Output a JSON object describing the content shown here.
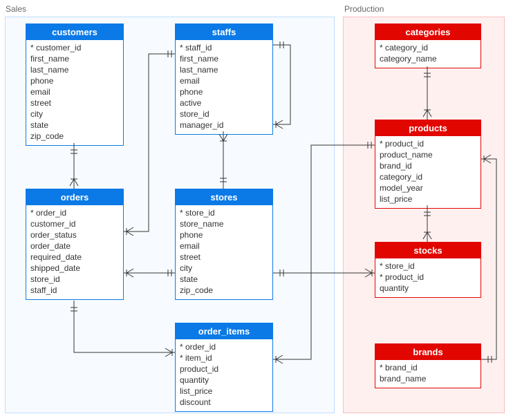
{
  "schemas": {
    "sales": {
      "label": "Sales"
    },
    "production": {
      "label": "Production"
    }
  },
  "entities": {
    "customers": {
      "title": "customers",
      "cols": [
        "* customer_id",
        "first_name",
        "last_name",
        "phone",
        "email",
        "street",
        "city",
        "state",
        "zip_code"
      ]
    },
    "staffs": {
      "title": "staffs",
      "cols": [
        "* staff_id",
        "first_name",
        "last_name",
        "email",
        "phone",
        "active",
        "store_id",
        "manager_id"
      ]
    },
    "orders": {
      "title": "orders",
      "cols": [
        "* order_id",
        "customer_id",
        "order_status",
        "order_date",
        "required_date",
        "shipped_date",
        "store_id",
        "staff_id"
      ]
    },
    "stores": {
      "title": "stores",
      "cols": [
        "* store_id",
        "store_name",
        "phone",
        "email",
        "street",
        "city",
        "state",
        "zip_code"
      ]
    },
    "order_items": {
      "title": "order_items",
      "cols": [
        "* order_id",
        "* item_id",
        "product_id",
        "quantity",
        "list_price",
        "discount"
      ]
    },
    "categories": {
      "title": "categories",
      "cols": [
        "* category_id",
        "category_name"
      ]
    },
    "products": {
      "title": "products",
      "cols": [
        "* product_id",
        "product_name",
        "brand_id",
        "category_id",
        "model_year",
        "list_price"
      ]
    },
    "stocks": {
      "title": "stocks",
      "cols": [
        "* store_id",
        "* product_id",
        "quantity"
      ]
    },
    "brands": {
      "title": "brands",
      "cols": [
        "* brand_id",
        "brand_name"
      ]
    }
  },
  "chart_data": {
    "type": "table",
    "title": "Database schema: Sales & Production",
    "schemas": [
      {
        "name": "Sales",
        "tables": [
          "customers",
          "staffs",
          "orders",
          "stores",
          "order_items"
        ]
      },
      {
        "name": "Production",
        "tables": [
          "categories",
          "products",
          "stocks",
          "brands"
        ]
      }
    ],
    "tables": {
      "customers": {
        "pk": [
          "customer_id"
        ],
        "columns": [
          "customer_id",
          "first_name",
          "last_name",
          "phone",
          "email",
          "street",
          "city",
          "state",
          "zip_code"
        ]
      },
      "staffs": {
        "pk": [
          "staff_id"
        ],
        "columns": [
          "staff_id",
          "first_name",
          "last_name",
          "email",
          "phone",
          "active",
          "store_id",
          "manager_id"
        ]
      },
      "orders": {
        "pk": [
          "order_id"
        ],
        "columns": [
          "order_id",
          "customer_id",
          "order_status",
          "order_date",
          "required_date",
          "shipped_date",
          "store_id",
          "staff_id"
        ]
      },
      "stores": {
        "pk": [
          "store_id"
        ],
        "columns": [
          "store_id",
          "store_name",
          "phone",
          "email",
          "street",
          "city",
          "state",
          "zip_code"
        ]
      },
      "order_items": {
        "pk": [
          "order_id",
          "item_id"
        ],
        "columns": [
          "order_id",
          "item_id",
          "product_id",
          "quantity",
          "list_price",
          "discount"
        ]
      },
      "categories": {
        "pk": [
          "category_id"
        ],
        "columns": [
          "category_id",
          "category_name"
        ]
      },
      "products": {
        "pk": [
          "product_id"
        ],
        "columns": [
          "product_id",
          "product_name",
          "brand_id",
          "category_id",
          "model_year",
          "list_price"
        ]
      },
      "stocks": {
        "pk": [
          "store_id",
          "product_id"
        ],
        "columns": [
          "store_id",
          "product_id",
          "quantity"
        ]
      },
      "brands": {
        "pk": [
          "brand_id"
        ],
        "columns": [
          "brand_id",
          "brand_name"
        ]
      }
    },
    "relationships": [
      {
        "from": "customers.customer_id",
        "to": "orders.customer_id",
        "type": "one-to-many"
      },
      {
        "from": "staffs.staff_id",
        "to": "orders.staff_id",
        "type": "one-to-many"
      },
      {
        "from": "staffs.staff_id",
        "to": "staffs.manager_id",
        "type": "one-to-many (self)"
      },
      {
        "from": "stores.store_id",
        "to": "staffs.store_id",
        "type": "one-to-many"
      },
      {
        "from": "stores.store_id",
        "to": "orders.store_id",
        "type": "one-to-many"
      },
      {
        "from": "stores.store_id",
        "to": "stocks.store_id",
        "type": "one-to-many"
      },
      {
        "from": "orders.order_id",
        "to": "order_items.order_id",
        "type": "one-to-many"
      },
      {
        "from": "products.product_id",
        "to": "order_items.product_id",
        "type": "one-to-many"
      },
      {
        "from": "products.product_id",
        "to": "stocks.product_id",
        "type": "one-to-many"
      },
      {
        "from": "categories.category_id",
        "to": "products.category_id",
        "type": "one-to-many"
      },
      {
        "from": "brands.brand_id",
        "to": "products.brand_id",
        "type": "one-to-many"
      }
    ]
  }
}
